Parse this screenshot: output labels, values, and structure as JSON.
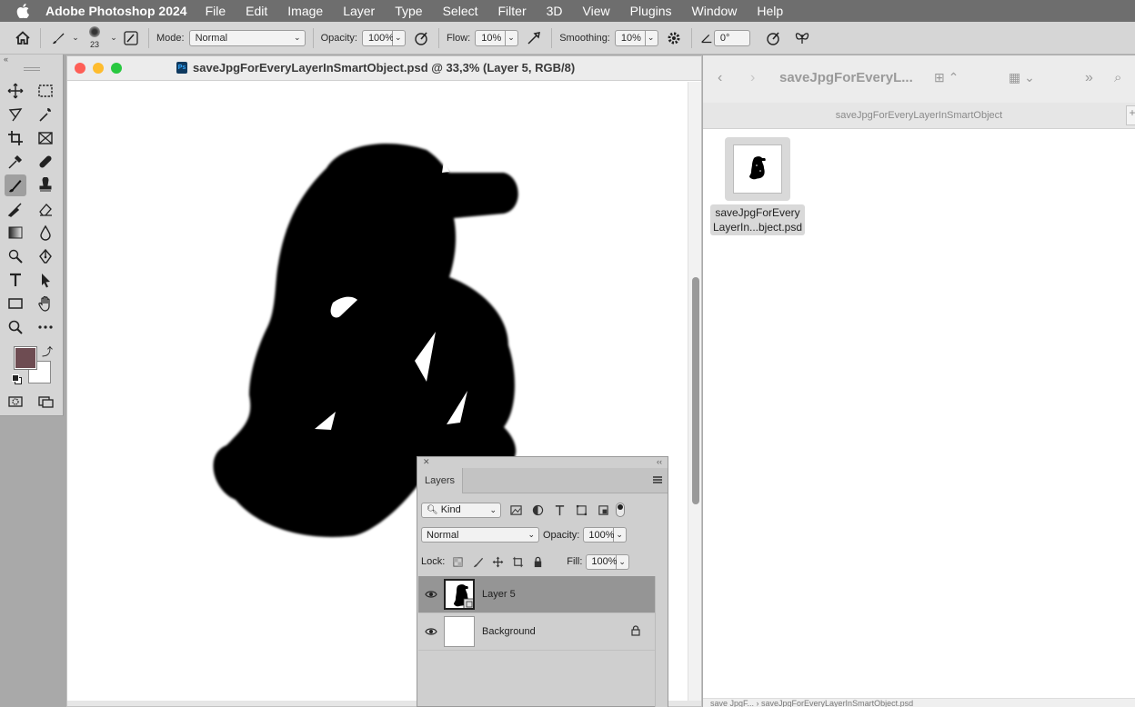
{
  "menubar": {
    "apple_icon": "apple-icon",
    "app_name": "Adobe Photoshop 2024",
    "items": [
      "File",
      "Edit",
      "Image",
      "Layer",
      "Type",
      "Select",
      "Filter",
      "3D",
      "View",
      "Plugins",
      "Window",
      "Help"
    ]
  },
  "options": {
    "brush_size": "23",
    "mode_label": "Mode:",
    "mode_value": "Normal",
    "opacity_label": "Opacity:",
    "opacity_value": "100%",
    "flow_label": "Flow:",
    "flow_value": "10%",
    "smoothing_label": "Smoothing:",
    "smoothing_value": "10%",
    "angle_value": "0°"
  },
  "colors": {
    "foreground": "#6e4c52",
    "background": "#ffffff"
  },
  "document": {
    "title": "saveJpgForEveryLayerInSmartObject.psd @ 33,3% (Layer 5, RGB/8)",
    "badge": "Ps"
  },
  "layers_panel": {
    "tab": "Layers",
    "filter_kind": "Kind",
    "blend_mode": "Normal",
    "opacity_label": "Opacity:",
    "opacity_value": "100%",
    "lock_label": "Lock:",
    "fill_label": "Fill:",
    "fill_value": "100%",
    "layers": [
      {
        "name": "Layer 5",
        "selected": true,
        "locked": false
      },
      {
        "name": "Background",
        "selected": false,
        "locked": true
      }
    ]
  },
  "finder": {
    "title": "saveJpgForEveryL...",
    "path_label": "saveJpgForEveryLayerInSmartObject",
    "file_name_line1": "saveJpgForEvery",
    "file_name_line2": "LayerIn...bject.psd",
    "breadcrumb": "save JpgF...  ›  saveJpgForEveryLayerInSmartObject.psd"
  }
}
